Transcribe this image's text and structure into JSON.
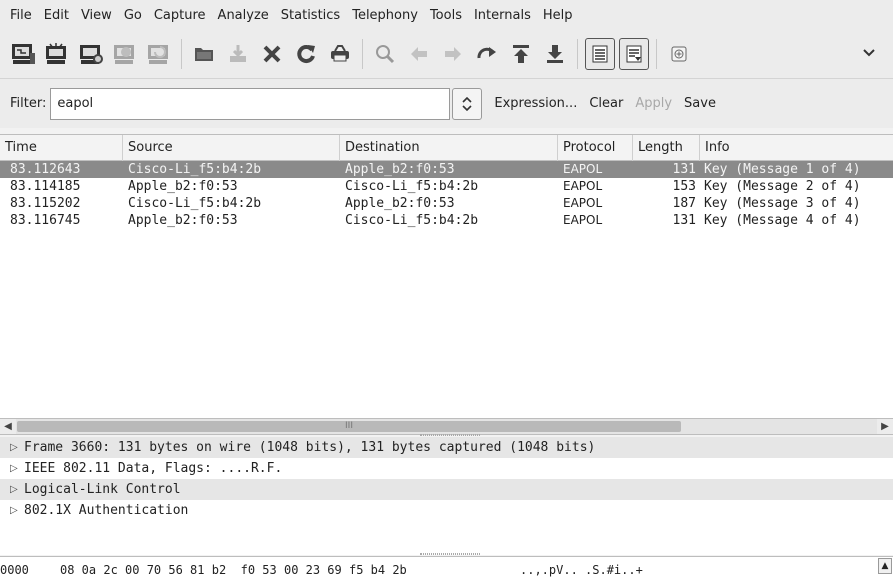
{
  "menu": [
    "File",
    "Edit",
    "View",
    "Go",
    "Capture",
    "Analyze",
    "Statistics",
    "Telephony",
    "Tools",
    "Internals",
    "Help"
  ],
  "toolbar": {
    "icons": [
      "interfaces-icon",
      "capture-options-icon",
      "start-capture-icon",
      "stop-capture-icon",
      "restart-capture-icon",
      "open-file-icon",
      "save-file-icon",
      "close-file-icon",
      "reload-icon",
      "print-icon",
      "find-packet-icon",
      "go-back-icon",
      "go-forward-icon",
      "go-to-packet-icon",
      "go-first-icon",
      "go-last-icon",
      "colorize-icon",
      "autoscroll-icon",
      "zoom-in-icon"
    ]
  },
  "filter": {
    "label": "Filter:",
    "value": "eapol",
    "expression_label": "Expression...",
    "clear_label": "Clear",
    "apply_label": "Apply",
    "save_label": "Save"
  },
  "packet_list": {
    "columns": [
      "Time",
      "Source",
      "Destination",
      "Protocol",
      "Length",
      "Info"
    ],
    "rows": [
      {
        "time": "83.112643",
        "source": "Cisco-Li_f5:b4:2b",
        "destination": "Apple_b2:f0:53",
        "protocol": "EAPOL",
        "length": "131",
        "info": "Key (Message 1 of 4)"
      },
      {
        "time": "83.114185",
        "source": "Apple_b2:f0:53",
        "destination": "Cisco-Li_f5:b4:2b",
        "protocol": "EAPOL",
        "length": "153",
        "info": "Key (Message 2 of 4)"
      },
      {
        "time": "83.115202",
        "source": "Cisco-Li_f5:b4:2b",
        "destination": "Apple_b2:f0:53",
        "protocol": "EAPOL",
        "length": "187",
        "info": "Key (Message 3 of 4)"
      },
      {
        "time": "83.116745",
        "source": "Apple_b2:f0:53",
        "destination": "Cisco-Li_f5:b4:2b",
        "protocol": "EAPOL",
        "length": "131",
        "info": "Key (Message 4 of 4)"
      }
    ],
    "selected_index": 0
  },
  "details": [
    "Frame 3660: 131 bytes on wire (1048 bits), 131 bytes captured (1048 bits)",
    "IEEE 802.11 Data, Flags: ....R.F.",
    "Logical-Link Control",
    "802.1X Authentication"
  ],
  "bytes": {
    "offset": "0000",
    "hex": "08 0a 2c 00 70 56 81 b2  f0 53 00 23 69 f5 b4 2b",
    "ascii": "..,.pV.. .S.#i..+"
  },
  "scrollbar": {
    "grip": "III"
  }
}
